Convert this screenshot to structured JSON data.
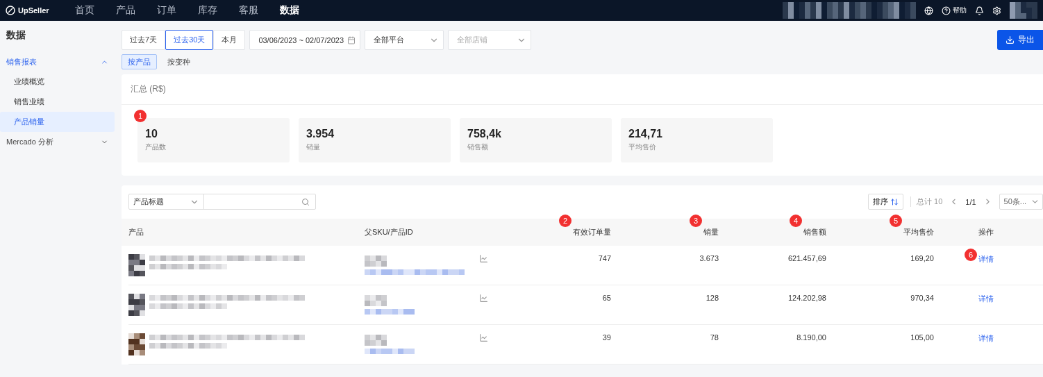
{
  "topbar": {
    "logo": "UpSeller",
    "nav": [
      {
        "label": "首页",
        "selected": false
      },
      {
        "label": "产品",
        "selected": false
      },
      {
        "label": "订单",
        "selected": false
      },
      {
        "label": "库存",
        "selected": false
      },
      {
        "label": "客服",
        "selected": false
      },
      {
        "label": "数据",
        "selected": true
      }
    ],
    "help": "帮助"
  },
  "sidebar": {
    "title": "数据",
    "groups": [
      {
        "label": "销售报表",
        "expanded": true,
        "selected": true,
        "children": [
          {
            "label": "业绩概览",
            "selected": false
          },
          {
            "label": "销售业绩",
            "selected": false
          },
          {
            "label": "产品销量",
            "selected": true
          }
        ]
      },
      {
        "label": "Mercado 分析",
        "expanded": false,
        "selected": false
      }
    ]
  },
  "filters": {
    "ranges": [
      {
        "label": "过去7天",
        "selected": false
      },
      {
        "label": "过去30天",
        "selected": true
      },
      {
        "label": "本月",
        "selected": false
      }
    ],
    "date_range": "03/06/2023 ~ 02/07/2023",
    "platform": {
      "value": "全部平台"
    },
    "store": {
      "placeholder": "全部店铺"
    },
    "export": "导出"
  },
  "view_tabs": [
    {
      "label": "按产品",
      "selected": true
    },
    {
      "label": "按变种",
      "selected": false
    }
  ],
  "summary": {
    "title": "汇总 (R$)",
    "stats": [
      {
        "value": "10",
        "label": "产品数",
        "marker": "1"
      },
      {
        "value": "3.954",
        "label": "销量"
      },
      {
        "value": "758,4k",
        "label": "销售额"
      },
      {
        "value": "214,71",
        "label": "平均售价"
      }
    ]
  },
  "table": {
    "search_field": "产品标题",
    "sort": "排序",
    "total": "总计 10",
    "page": "1/1",
    "page_size": "50条...",
    "columns": [
      {
        "label": "产品"
      },
      {
        "label": "父SKU/产品ID"
      },
      {
        "label": "有效订单量",
        "marker": "2"
      },
      {
        "label": "销量",
        "marker": "3"
      },
      {
        "label": "销售额",
        "marker": "4"
      },
      {
        "label": "平均售价",
        "marker": "5"
      },
      {
        "label": "操作"
      }
    ],
    "rows": [
      {
        "orders": "747",
        "sales": "3.673",
        "amount": "621.457,69",
        "avg": "169,20",
        "action": "详情",
        "marker": "6"
      },
      {
        "orders": "65",
        "sales": "128",
        "amount": "124.202,98",
        "avg": "970,34",
        "action": "详情"
      },
      {
        "orders": "39",
        "sales": "78",
        "amount": "8.190,00",
        "avg": "105,00",
        "action": "详情"
      }
    ]
  }
}
